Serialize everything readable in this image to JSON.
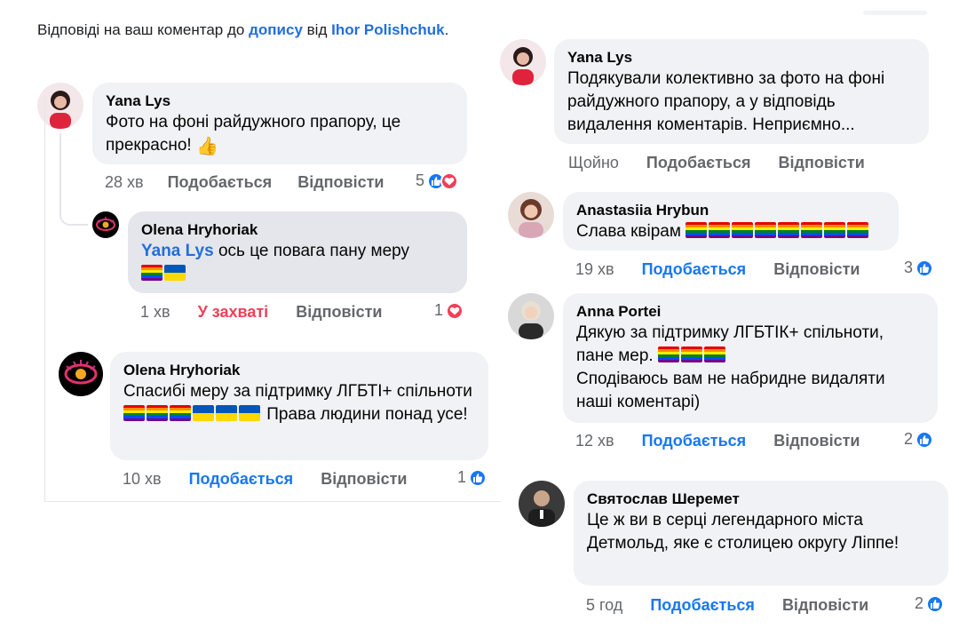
{
  "header": {
    "prefix": "Відповіді на ваш коментар до ",
    "link_post": "допису",
    "middle": " від ",
    "link_author": "Ihor Polishchuk",
    "suffix": "."
  },
  "left": {
    "c1": {
      "author": "Yana Lys",
      "text": "Фото на фоні райдужного прапору, це прекрасно! ",
      "time": "28 хв",
      "like": "Подобається",
      "reply": "Відповісти",
      "count": "5"
    },
    "c2": {
      "author": "Olena Hryhoriak",
      "mention": "Yana Lys",
      "text": " ось це повага пану меру",
      "time": "1 хв",
      "like": "У захваті",
      "reply": "Відповісти",
      "count": "1"
    },
    "c3": {
      "author": "Olena Hryhoriak",
      "text_a": "Спасибі меру за підтримку ЛГБТІ+ спільноти ",
      "text_b": " Права людини понад усе!",
      "time": "10 хв",
      "like": "Подобається",
      "reply": "Відповісти",
      "count": "1"
    }
  },
  "right": {
    "c1": {
      "author": "Yana Lys",
      "text": "Подякували колективно за фото на фоні райдужного прапору, а у відповідь видалення коментарів. Неприємно...",
      "time": "Щойно",
      "like": "Подобається",
      "reply": "Відповісти"
    },
    "c2": {
      "author": "Anastasiia Hrybun",
      "text": "Слава квірам ",
      "time": "19 хв",
      "like": "Подобається",
      "reply": "Відповісти",
      "count": "3"
    },
    "c3": {
      "author": "Anna Portei",
      "text_a": "Дякую за підтримку ЛГБТІК+ спільноти, пане мер. ",
      "text_b": "Сподіваюсь вам не набридне видаляти наші коментарі)",
      "time": "12 хв",
      "like": "Подобається",
      "reply": "Відповісти",
      "count": "2"
    },
    "c4": {
      "author": "Святослав Шеремет",
      "text": "Це ж ви в серці легендарного міста Детмольд, яке є столицею округу Ліппе!",
      "time": "5 год",
      "like": "Подобається",
      "reply": "Відповісти",
      "count": "2"
    }
  },
  "icons": {
    "like": "thumbs-up-icon",
    "love": "heart-icon",
    "thumb_emoji": "👍"
  },
  "colors": {
    "link": "#216fdb",
    "like_blue": "#1877f2",
    "love_red": "#f33e58",
    "bubble": "#f0f2f5",
    "meta": "#65676b"
  }
}
